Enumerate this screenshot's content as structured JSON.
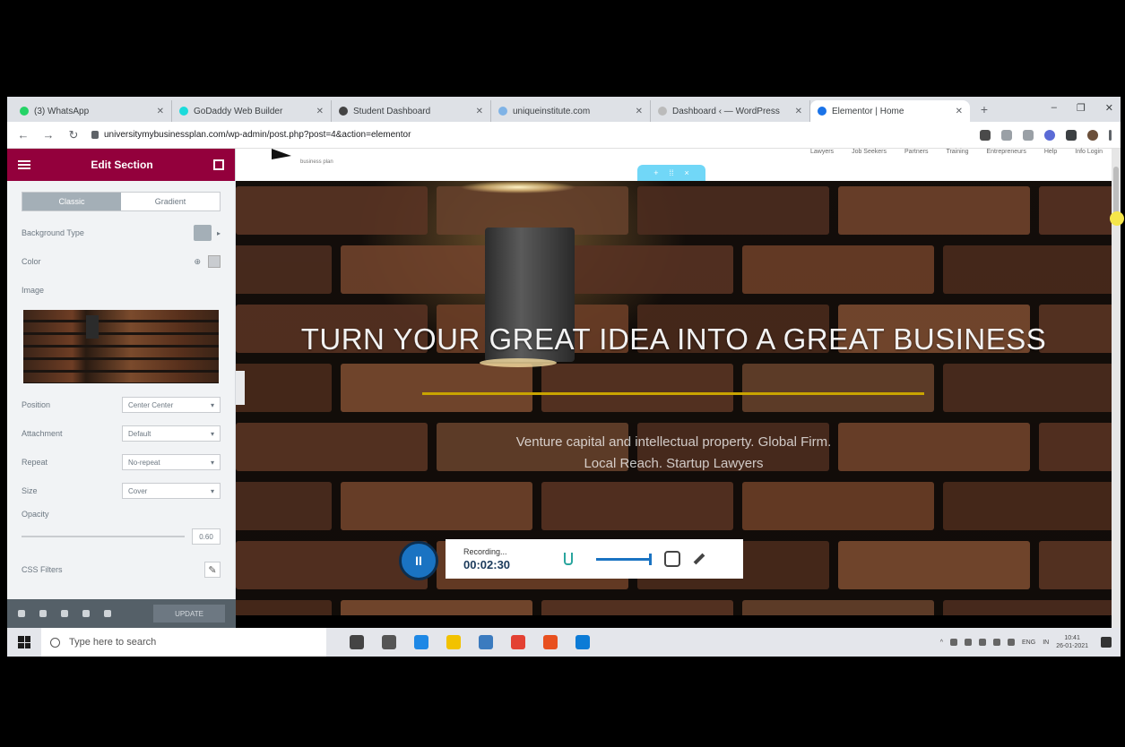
{
  "browser": {
    "tabs": [
      {
        "title": "(3) WhatsApp",
        "color": "#25d366"
      },
      {
        "title": "GoDaddy Web Builder",
        "color": "#1bdbdb"
      },
      {
        "title": "Student Dashboard",
        "color": "#444444"
      },
      {
        "title": "uniqueinstitute.com",
        "color": "#7fb3e6"
      },
      {
        "title": "Dashboard ‹ — WordPress",
        "color": "#bbbbbb"
      },
      {
        "title": "Elementor | Home",
        "color": "#1a73e8",
        "active": true
      }
    ],
    "url": "universitymybusinessplan.com/wp-admin/post.php?post=4&action=elementor",
    "window_controls": [
      "–",
      "❐",
      "✕"
    ]
  },
  "panel": {
    "title": "Edit Section",
    "tabs": [
      "Classic",
      "Gradient"
    ],
    "fields": [
      {
        "label": "Background Type"
      },
      {
        "label": "Color"
      },
      {
        "label": "Image"
      }
    ],
    "selects": [
      {
        "label": "Position",
        "value": "Center Center"
      },
      {
        "label": "Attachment",
        "value": "Default"
      },
      {
        "label": "Repeat",
        "value": "No-repeat"
      },
      {
        "label": "Size",
        "value": "Cover"
      }
    ],
    "opacity": {
      "label": "Opacity",
      "value": "0.60"
    },
    "css_filters_label": "CSS Filters",
    "update_label": "UPDATE"
  },
  "site": {
    "logo_text": "business plan",
    "menu": [
      "Lawyers",
      "Job Seekers",
      "Partners",
      "Training",
      "Entrepreneurs",
      "Help",
      "Info Login"
    ],
    "headline": "TURN YOUR GREAT IDEA INTO A GREAT BUSINESS",
    "subline1": "Venture capital and intellectual property. Global Firm.",
    "subline2": "Local Reach. Startup Lawyers"
  },
  "recorder": {
    "status": "Recording...",
    "time": "00:02:30"
  },
  "taskbar": {
    "search_placeholder": "Type here to search",
    "apps": [
      "#444444",
      "#555555",
      "#1e88e5",
      "#f2c200",
      "#3b7bbf",
      "#e34133",
      "#e8501f",
      "#0c7bd6"
    ],
    "lang": "ENG",
    "region": "IN",
    "time": "10:41",
    "date": "26-01-2021"
  },
  "colors": {
    "elementor_accent": "#93003c",
    "divider_gold": "#c9a400",
    "recorder_blue": "#1a73c2"
  }
}
